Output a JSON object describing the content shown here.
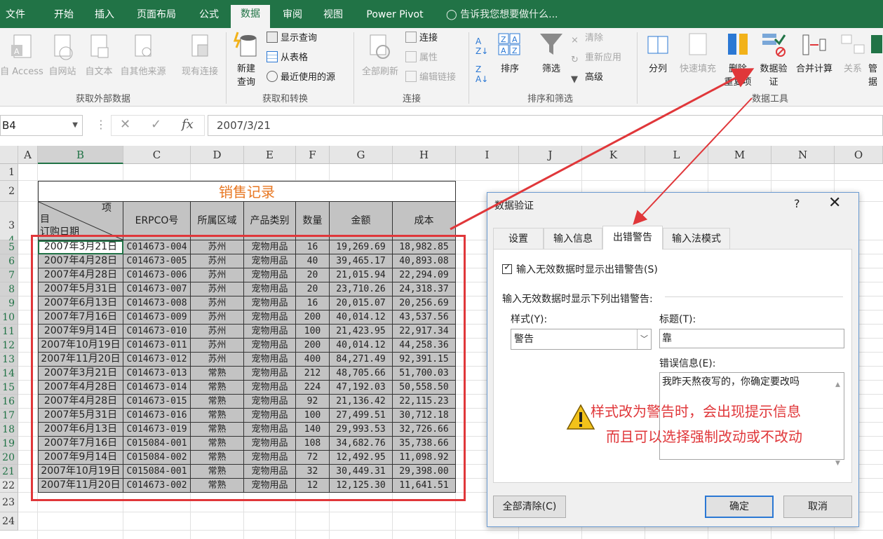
{
  "ribbon_tabs": [
    "文件",
    "开始",
    "插入",
    "页面布局",
    "公式",
    "数据",
    "审阅",
    "视图",
    "Power Pivot"
  ],
  "active_tab": "数据",
  "tell_me": "告诉我您想要做什么...",
  "groups": {
    "external": {
      "label": "获取外部数据",
      "items": [
        "自 Access",
        "自网站",
        "自文本",
        "自其他来源",
        "现有连接"
      ]
    },
    "transform": {
      "label": "获取和转换",
      "new_query": "新建",
      "new_query2": "查询",
      "show_query": "显示查询",
      "from_table": "从表格",
      "recent": "最近使用的源"
    },
    "connections": {
      "label": "连接",
      "refresh_all": "全部刷新",
      "connections": "连接",
      "properties": "属性",
      "edit_links": "编辑链接"
    },
    "sort": {
      "label": "排序和筛选",
      "sort": "排序",
      "filter": "筛选",
      "clear": "清除",
      "reapply": "重新应用",
      "advanced": "高级"
    },
    "tools": {
      "label": "数据工具",
      "text_to_cols": "分列",
      "flash_fill": "快速填充",
      "remove_dup": "删除",
      "remove_dup2": "重复项",
      "validation": "数据验",
      "validation2": "证",
      "consolidate": "合并计算",
      "relations": "关系",
      "manage": "管",
      "manage2": "据"
    }
  },
  "formula_bar": {
    "name_box": "B4",
    "fx": "fx",
    "value": "2007/3/21"
  },
  "columns": [
    "A",
    "B",
    "C",
    "D",
    "E",
    "F",
    "G",
    "H",
    "I",
    "J",
    "K",
    "L",
    "M",
    "N",
    "O"
  ],
  "rows": [
    "1",
    "2",
    "3",
    "4",
    "5",
    "6",
    "7",
    "8",
    "9",
    "10",
    "11",
    "12",
    "13",
    "14",
    "15",
    "16",
    "17",
    "18",
    "19",
    "20",
    "21",
    "22",
    "23",
    "24"
  ],
  "sheet": {
    "title": "销售记录",
    "header_diag_top": "项",
    "header_diag_mid": "目",
    "header_diag_bottom": "订购日期",
    "headers": [
      "ERPCO号",
      "所属区域",
      "产品类别",
      "数量",
      "金额",
      "成本"
    ],
    "records": [
      [
        "2007年3月21日",
        "C014673-004",
        "苏州",
        "宠物用品",
        "16",
        "19,269.69",
        "18,982.85"
      ],
      [
        "2007年4月28日",
        "C014673-005",
        "苏州",
        "宠物用品",
        "40",
        "39,465.17",
        "40,893.08"
      ],
      [
        "2007年4月28日",
        "C014673-006",
        "苏州",
        "宠物用品",
        "20",
        "21,015.94",
        "22,294.09"
      ],
      [
        "2007年5月31日",
        "C014673-007",
        "苏州",
        "宠物用品",
        "20",
        "23,710.26",
        "24,318.37"
      ],
      [
        "2007年6月13日",
        "C014673-008",
        "苏州",
        "宠物用品",
        "16",
        "20,015.07",
        "20,256.69"
      ],
      [
        "2007年7月16日",
        "C014673-009",
        "苏州",
        "宠物用品",
        "200",
        "40,014.12",
        "43,537.56"
      ],
      [
        "2007年9月14日",
        "C014673-010",
        "苏州",
        "宠物用品",
        "100",
        "21,423.95",
        "22,917.34"
      ],
      [
        "2007年10月19日",
        "C014673-011",
        "苏州",
        "宠物用品",
        "200",
        "40,014.12",
        "44,258.36"
      ],
      [
        "2007年11月20日",
        "C014673-012",
        "苏州",
        "宠物用品",
        "400",
        "84,271.49",
        "92,391.15"
      ],
      [
        "2007年3月21日",
        "C014673-013",
        "常熟",
        "宠物用品",
        "212",
        "48,705.66",
        "51,700.03"
      ],
      [
        "2007年4月28日",
        "C014673-014",
        "常熟",
        "宠物用品",
        "224",
        "47,192.03",
        "50,558.50"
      ],
      [
        "2007年4月28日",
        "C014673-015",
        "常熟",
        "宠物用品",
        "92",
        "21,136.42",
        "22,115.23"
      ],
      [
        "2007年5月31日",
        "C014673-016",
        "常熟",
        "宠物用品",
        "100",
        "27,499.51",
        "30,712.18"
      ],
      [
        "2007年6月13日",
        "C014673-019",
        "常熟",
        "宠物用品",
        "140",
        "29,993.53",
        "32,726.66"
      ],
      [
        "2007年7月16日",
        "C015084-001",
        "常熟",
        "宠物用品",
        "108",
        "34,682.76",
        "35,738.66"
      ],
      [
        "2007年9月14日",
        "C015084-002",
        "常熟",
        "宠物用品",
        "72",
        "12,492.95",
        "11,098.92"
      ],
      [
        "2007年10月19日",
        "C015084-001",
        "常熟",
        "宠物用品",
        "32",
        "30,449.31",
        "29,398.00"
      ],
      [
        "2007年11月20日",
        "C014673-002",
        "常熟",
        "宠物用品",
        "12",
        "12,125.30",
        "11,641.51"
      ]
    ]
  },
  "dialog": {
    "title": "数据验证",
    "help": "?",
    "close": "✕",
    "tabs": [
      "设置",
      "输入信息",
      "出错警告",
      "输入法模式"
    ],
    "active_tab": "出错警告",
    "checkbox_label": "输入无效数据时显示出错警告(S)",
    "section_label": "输入无效数据时显示下列出错警告:",
    "style_label": "样式(Y):",
    "style_value": "警告",
    "title_label": "标题(T):",
    "title_value": "靠",
    "message_label": "错误信息(E):",
    "message_value": "我昨天熬夜写的，你确定要改吗",
    "clear_all": "全部清除(C)",
    "ok": "确定",
    "cancel": "取消"
  },
  "annotation": {
    "line1": "样式改为警告时，会出现提示信息",
    "line2": "而且可以选择强制改动或不改动",
    "color": "#e0373a"
  },
  "colors": {
    "excel_green": "#217346",
    "accent_red": "#e0373a",
    "grey_fill": "#c3c3c3"
  }
}
